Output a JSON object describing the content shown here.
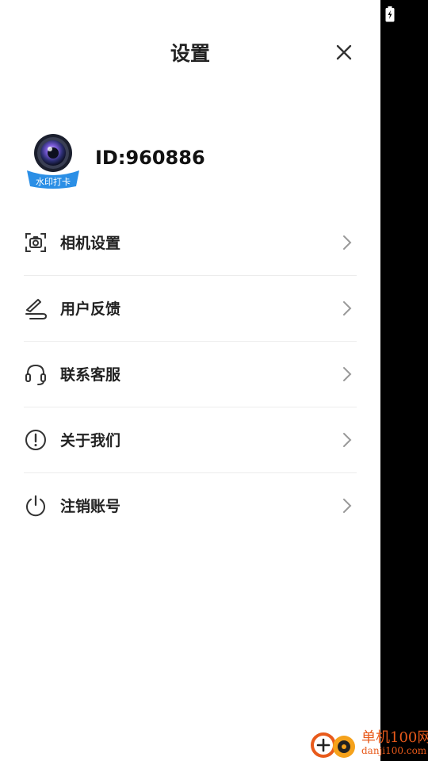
{
  "status_bar": {
    "battery_icon": "battery-charging-icon"
  },
  "header": {
    "title": "设置",
    "close_icon": "close-icon"
  },
  "profile": {
    "avatar_icon": "camera-lens-logo",
    "avatar_badge_text": "水印打卡",
    "user_id": "ID:960886"
  },
  "menu": {
    "items": [
      {
        "label": "相机设置",
        "icon": "camera-settings-icon"
      },
      {
        "label": "用户反馈",
        "icon": "feedback-pen-icon"
      },
      {
        "label": "联系客服",
        "icon": "headset-icon"
      },
      {
        "label": "关于我们",
        "icon": "info-exclamation-icon"
      },
      {
        "label": "注销账号",
        "icon": "power-icon"
      }
    ],
    "chevron_icon": "chevron-right-icon"
  },
  "watermark": {
    "brand": "单机100网",
    "domain": "danji100.com"
  },
  "colors": {
    "panel_bg": "#ffffff",
    "side_bg": "#000000",
    "text": "#222222",
    "icon": "#333333",
    "divider": "#ececec",
    "chevron": "#999999",
    "watermark": "#e85a1b"
  }
}
